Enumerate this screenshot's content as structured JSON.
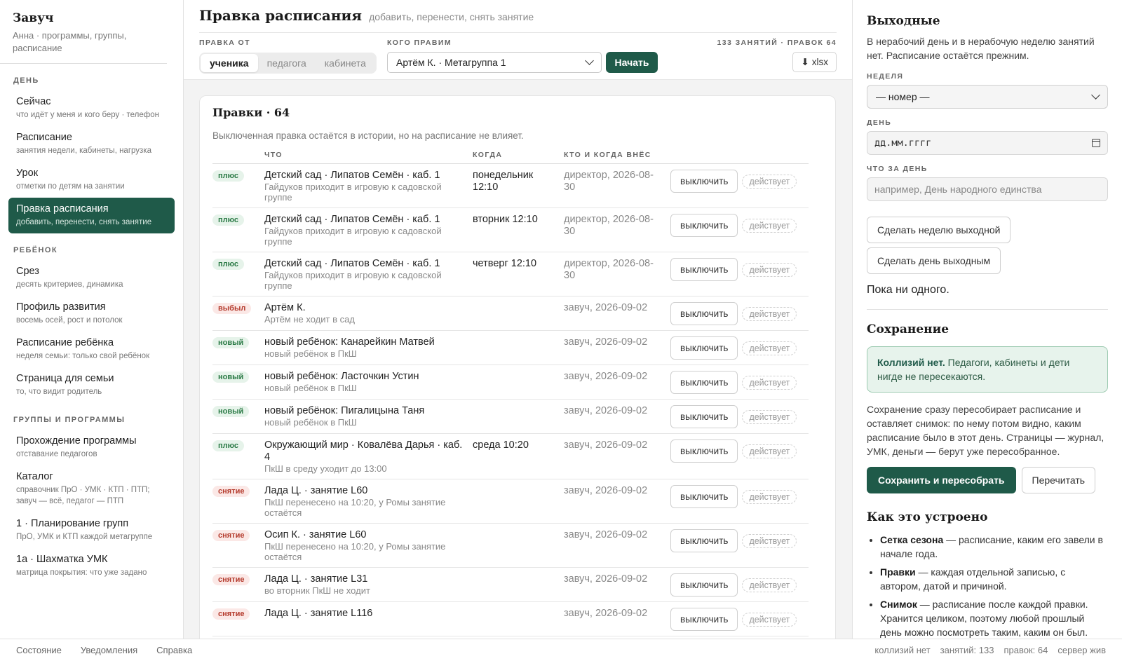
{
  "sidebar": {
    "brand_title": "Завуч",
    "brand_sub": "Анна · программы, группы, расписание",
    "sections": [
      {
        "title": "день",
        "items": [
          {
            "label": "Сейчас",
            "desc": "что идёт у меня и кого беру · телефон"
          },
          {
            "label": "Расписание",
            "desc": "занятия недели, кабинеты, нагрузка"
          },
          {
            "label": "Урок",
            "desc": "отметки по детям на занятии"
          },
          {
            "label": "Правка расписания",
            "desc": "добавить, перенести, снять занятие",
            "active": true
          }
        ]
      },
      {
        "title": "ребёнок",
        "items": [
          {
            "label": "Срез",
            "desc": "десять критериев, динамика"
          },
          {
            "label": "Профиль развития",
            "desc": "восемь осей, рост и потолок"
          },
          {
            "label": "Расписание ребёнка",
            "desc": "неделя семьи: только свой ребёнок"
          },
          {
            "label": "Страница для семьи",
            "desc": "то, что видит родитель"
          }
        ]
      },
      {
        "title": "группы и программы",
        "items": [
          {
            "label": "Прохождение программы",
            "desc": "отставание педагогов"
          },
          {
            "label": "Каталог",
            "desc": "справочник ПрО · УМК · КТП · ПТП; завуч — всё, педагог — ПТП"
          },
          {
            "label": "1 · Планирование групп",
            "desc": "ПрО, УМК и КТП каждой метагруппе"
          },
          {
            "label": "1а · Шахматка УМК",
            "desc": "матрица покрытия: что уже задано"
          }
        ]
      }
    ]
  },
  "header": {
    "title": "Правка расписания",
    "subtitle": "добавить, перенести, снять занятие",
    "from_label": "правка от",
    "from_options": [
      "ученика",
      "педагога",
      "кабинета"
    ],
    "from_selected": 0,
    "whom_label": "кого правим",
    "whom_value": "Артём К. · Метагруппа 1",
    "start_label": "Начать",
    "counts": "133 занятий · правок 64",
    "xlsx_icon": "⬇",
    "xlsx_label": "xlsx"
  },
  "edits": {
    "title": "Правки · 64",
    "note": "Выключенная правка остаётся в истории, но на расписание не влияет.",
    "columns": [
      "",
      "что",
      "когда",
      "кто и когда внёс",
      ""
    ],
    "off_label": "выключить",
    "status_label": "действует",
    "rows": [
      {
        "badge": "плюс",
        "tone": "green",
        "main": "Детский сад · Липатов Семён · каб. 1",
        "sub": "Гайдуков приходит в игровую к садовской группе",
        "when": "понедельник 12:10",
        "who": "директор, 2026-08-30"
      },
      {
        "badge": "плюс",
        "tone": "green",
        "main": "Детский сад · Липатов Семён · каб. 1",
        "sub": "Гайдуков приходит в игровую к садовской группе",
        "when": "вторник 12:10",
        "who": "директор, 2026-08-30"
      },
      {
        "badge": "плюс",
        "tone": "green",
        "main": "Детский сад · Липатов Семён · каб. 1",
        "sub": "Гайдуков приходит в игровую к садовской группе",
        "when": "четверг 12:10",
        "who": "директор, 2026-08-30"
      },
      {
        "badge": "выбыл",
        "tone": "red",
        "main": "Артём К.",
        "sub": "Артём не ходит в сад",
        "when": "",
        "who": "завуч, 2026-09-02"
      },
      {
        "badge": "новый",
        "tone": "green",
        "main": "новый ребёнок: Канарейкин Матвей",
        "sub": "новый ребёнок в ПкШ",
        "when": "",
        "who": "завуч, 2026-09-02"
      },
      {
        "badge": "новый",
        "tone": "green",
        "main": "новый ребёнок: Ласточкин Устин",
        "sub": "новый ребёнок в ПкШ",
        "when": "",
        "who": "завуч, 2026-09-02"
      },
      {
        "badge": "новый",
        "tone": "green",
        "main": "новый ребёнок: Пигалицына Таня",
        "sub": "новый ребёнок в ПкШ",
        "when": "",
        "who": "завуч, 2026-09-02"
      },
      {
        "badge": "плюс",
        "tone": "green",
        "main": "Окружающий мир · Ковалёва Дарья · каб. 4",
        "sub": "ПкШ в среду уходит до 13:00",
        "when": "среда 10:20",
        "who": "завуч, 2026-09-02"
      },
      {
        "badge": "снятие",
        "tone": "red",
        "main": "Лада Ц. · занятие L60",
        "sub": "ПкШ перенесено на 10:20, у Ромы занятие остаётся",
        "when": "",
        "who": "завуч, 2026-09-02"
      },
      {
        "badge": "снятие",
        "tone": "red",
        "main": "Осип К. · занятие L60",
        "sub": "ПкШ перенесено на 10:20, у Ромы занятие остаётся",
        "when": "",
        "who": "завуч, 2026-09-02"
      },
      {
        "badge": "снятие",
        "tone": "red",
        "main": "Лада Ц. · занятие L31",
        "sub": "во вторник ПкШ не ходит",
        "when": "",
        "who": "завуч, 2026-09-02"
      },
      {
        "badge": "снятие",
        "tone": "red",
        "main": "Лада Ц. · занятие L116",
        "sub": "",
        "when": "",
        "who": "завуч, 2026-09-02"
      }
    ]
  },
  "right": {
    "holidays_title": "Выходные",
    "holidays_text": "В нерабочий день и в нерабочую неделю занятий нет. Расписание остаётся прежним.",
    "week_label": "неделя",
    "week_value": "— номер —",
    "day_label": "день",
    "day_placeholder": "дд.мм.гггг",
    "what_label": "что за день",
    "what_placeholder": "например, День народного единства",
    "make_week_btn": "Сделать неделю выходной",
    "make_day_btn": "Сделать день выходным",
    "none_yet": "Пока ни одного.",
    "save_title": "Сохранение",
    "ok_bold": "Коллизий нет.",
    "ok_text": "Педагоги, кабинеты и дети нигде не пересекаются.",
    "save_text": "Сохранение сразу пересобирает расписание и оставляет снимок: по нему потом видно, каким расписание было в этот день. Страницы — журнал, УМК, деньги — берут уже пересобранное.",
    "save_btn": "Сохранить и пересобрать",
    "reread_btn": "Перечитать",
    "how_title": "Как это устроено",
    "how_items": [
      {
        "term": "Сетка сезона",
        "text": " — расписание, каким его завели в начале года."
      },
      {
        "term": "Правки",
        "text": " — каждая отдельной записью, с автором, датой и причиной."
      },
      {
        "term": "Снимок",
        "text": " — расписание после каждой правки. Хранится целиком, поэтому любой прошлый день можно посмотреть таким, каким он был."
      }
    ]
  },
  "footer": {
    "links": [
      "Состояние",
      "Уведомления",
      "Справка"
    ],
    "stats": [
      "коллизий нет",
      "занятий: 133",
      "правок: 64",
      "сервер жив"
    ]
  }
}
